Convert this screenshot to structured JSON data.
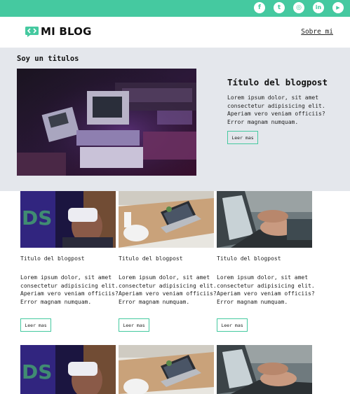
{
  "brand": {
    "name": "MI BLOG",
    "accent_color": "#45c9a0",
    "icon": "code-brackets-icon"
  },
  "social": [
    {
      "name": "facebook-icon",
      "glyph": "f"
    },
    {
      "name": "tumblr-icon",
      "glyph": "t"
    },
    {
      "name": "instagram-icon",
      "glyph": "◎"
    },
    {
      "name": "linkedin-icon",
      "glyph": "in"
    },
    {
      "name": "youtube-icon",
      "glyph": "▶"
    }
  ],
  "nav": {
    "about_label": "Sobre mi"
  },
  "hero": {
    "section_label": "Soy un titulos",
    "title": "Título del blogpost",
    "body": "Lorem ipsum dolor, sit amet consectetur adipisicing elit. Aperiam vero veniam officiis? Error magnam numquam.",
    "button_label": "Leer mas",
    "image": "retro-computer-photo"
  },
  "cards": [
    {
      "title": "Titulo del blogpost",
      "body": "Lorem ipsum dolor, sit amet consectetur adipisicing elit. Aperiam vero veniam officiis? Error magnam numquam.",
      "button_label": "Leer mas",
      "image": "vr-headset-photo"
    },
    {
      "title": "Titulo del blogpost",
      "body": "Lorem ipsum dolor, sit amet consectetur adipisicing elit. Aperiam vero veniam officiis? Error magnam numquam.",
      "button_label": "Leer mas",
      "image": "laptop-desk-photo"
    },
    {
      "title": "Titulo del blogpost",
      "body": "Lorem ipsum dolor, sit amet consectetur adipisicing elit. Aperiam vero veniam officiis? Error magnam numquam.",
      "button_label": "Leer mas",
      "image": "typing-laptop-photo"
    }
  ]
}
